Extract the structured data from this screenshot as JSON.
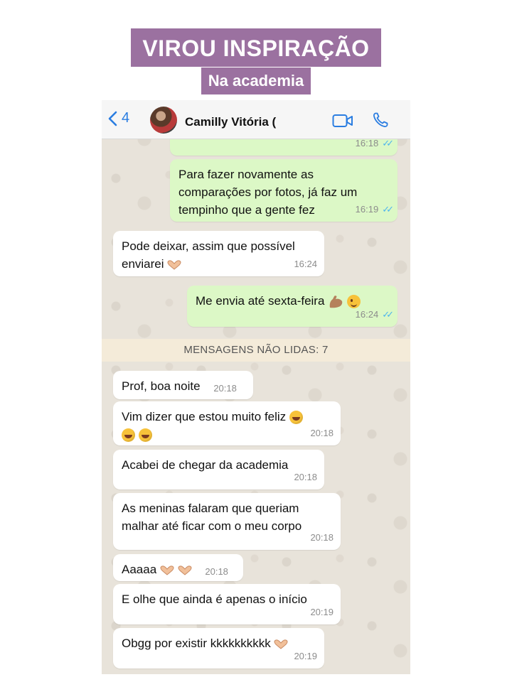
{
  "header": {
    "title": "VIROU INSPIRAÇÃO",
    "subtitle": "Na academia"
  },
  "chat": {
    "back_count": "4",
    "contact_name": "Camilly Vitória (",
    "accent_color": "#2a7de1",
    "icons": [
      "chevron-left-icon",
      "video-call-icon",
      "phone-call-icon"
    ]
  },
  "messages": [
    {
      "direction": "outgoing",
      "text": "",
      "time": "16:18",
      "read": true
    },
    {
      "direction": "outgoing",
      "lines": [
        "Para fazer novamente as",
        "comparações por fotos, já faz um",
        "tempinho que a gente fez"
      ],
      "time": "16:19",
      "read": true
    },
    {
      "direction": "incoming",
      "lines": [
        "Pode deixar, assim que possível",
        "enviarei"
      ],
      "emoji": "heart-hands",
      "time": "16:24"
    },
    {
      "direction": "outgoing",
      "text": "Me envia até sexta-feira",
      "emoji": "flexed-biceps, winking-face",
      "time": "16:24",
      "read": true
    },
    {
      "direction": "incoming",
      "text": "Prof, boa noite",
      "time": "20:18"
    },
    {
      "direction": "incoming",
      "text": "Vim dizer que estou muito feliz",
      "emoji": "rolling-laughing x3",
      "time": "20:18"
    },
    {
      "direction": "incoming",
      "text": "Acabei de chegar da academia",
      "time": "20:18"
    },
    {
      "direction": "incoming",
      "lines": [
        "As meninas falaram que queriam",
        "malhar até ficar com o meu corpo"
      ],
      "time": "20:18"
    },
    {
      "direction": "incoming",
      "text": "Aaaaa",
      "emoji": "heart-hands x2",
      "time": "20:18"
    },
    {
      "direction": "incoming",
      "text": "E olhe que ainda é apenas o início",
      "time": "20:19"
    },
    {
      "direction": "incoming",
      "text": "Obgg por existir kkkkkkkkkk",
      "emoji": "heart-hands",
      "time": "20:19"
    }
  ],
  "unread_divider": "MENSAGENS NÃO LIDAS: 7",
  "colors": {
    "banner": "#9b71a0",
    "outgoing_bubble": "#dcf8c6",
    "incoming_bubble": "#ffffff",
    "chat_background": "#e8e3da",
    "read_ticks": "#4fb6ec"
  }
}
